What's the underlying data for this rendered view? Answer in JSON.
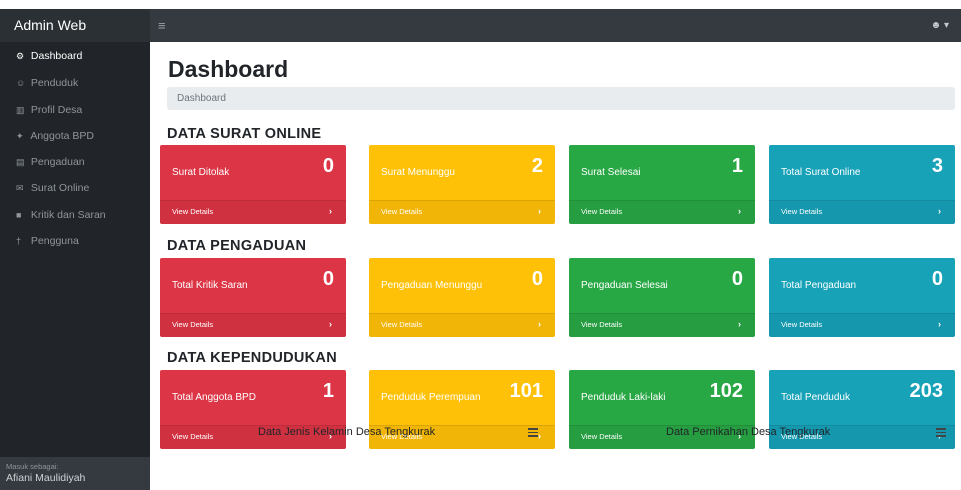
{
  "topbar": {
    "brand": "Admin Web",
    "toggle_icon": "bars-icon",
    "user_menu_icon": "user-dropdown-icon"
  },
  "sidebar": {
    "items": [
      {
        "label": "Dashboard",
        "icon": "dashboard-icon",
        "glyph": "⚙",
        "active": true
      },
      {
        "label": "Penduduk",
        "icon": "user-icon",
        "glyph": "☺",
        "active": false
      },
      {
        "label": "Profil Desa",
        "icon": "building-icon",
        "glyph": "▥",
        "active": false
      },
      {
        "label": "Anggota BPD",
        "icon": "users-icon",
        "glyph": "✦",
        "active": false
      },
      {
        "label": "Pengaduan",
        "icon": "list-icon",
        "glyph": "▤",
        "active": false
      },
      {
        "label": "Surat Online",
        "icon": "envelope-icon",
        "glyph": "✉",
        "active": false
      },
      {
        "label": "Kritik dan Saran",
        "icon": "comment-icon",
        "glyph": "■",
        "active": false
      },
      {
        "label": "Pengguna",
        "icon": "key-icon",
        "glyph": "†",
        "active": false
      }
    ],
    "footer_label": "Masuk sebagai:",
    "footer_user": "Afiani Maulidiyah"
  },
  "main": {
    "page_title": "Dashboard",
    "breadcrumb": "Dashboard",
    "sections": [
      {
        "title": "DATA SURAT ONLINE",
        "cards": [
          {
            "label": "Surat Ditolak",
            "value": "0",
            "color": "#dc3545",
            "link": "View Details"
          },
          {
            "label": "Surat Menunggu",
            "value": "2",
            "color": "#ffc107",
            "link": "View Details"
          },
          {
            "label": "Surat Selesai",
            "value": "1",
            "color": "#28a745",
            "link": "View Details"
          },
          {
            "label": "Total Surat Online",
            "value": "3",
            "color": "#17a2b8",
            "link": "View Details"
          }
        ]
      },
      {
        "title": "DATA PENGADUAN",
        "cards": [
          {
            "label": "Total Kritik Saran",
            "value": "0",
            "color": "#dc3545",
            "link": "View Details"
          },
          {
            "label": "Pengaduan Menunggu",
            "value": "0",
            "color": "#ffc107",
            "link": "View Details"
          },
          {
            "label": "Pengaduan Selesai",
            "value": "0",
            "color": "#28a745",
            "link": "View Details"
          },
          {
            "label": "Total Pengaduan",
            "value": "0",
            "color": "#17a2b8",
            "link": "View Details"
          }
        ]
      },
      {
        "title": "DATA KEPENDUDUKAN",
        "cards": [
          {
            "label": "Total Anggota BPD",
            "value": "1",
            "color": "#dc3545",
            "link": "View Details"
          },
          {
            "label": "Penduduk Perempuan",
            "value": "101",
            "color": "#ffc107",
            "link": "View Details"
          },
          {
            "label": "Penduduk Laki-laki",
            "value": "102",
            "color": "#28a745",
            "link": "View Details"
          },
          {
            "label": "Total Penduduk",
            "value": "203",
            "color": "#17a2b8",
            "link": "View Details"
          }
        ]
      }
    ],
    "charts": [
      {
        "title": "Data Jenis Kelamin Desa Tengkurak",
        "menu_icon": "hamburger-menu-icon"
      },
      {
        "title": "Data Pernikahan Desa Tengkurak",
        "menu_icon": "hamburger-menu-icon"
      }
    ]
  }
}
